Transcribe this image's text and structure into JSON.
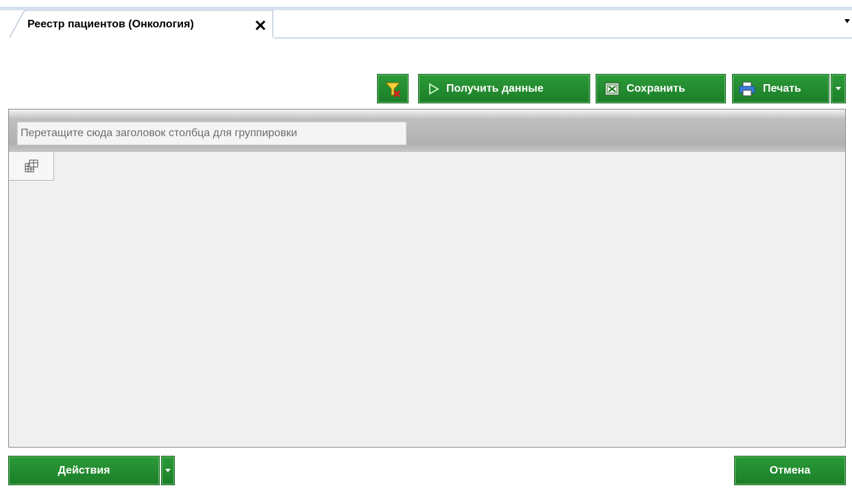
{
  "tabs": [
    {
      "label": "Реестр пациентов (Онкология)",
      "active": true
    }
  ],
  "toolbar": {
    "get_data_label": "Получить данные",
    "save_label": "Сохранить",
    "print_label": "Печать"
  },
  "grid": {
    "group_panel_hint": "Перетащите сюда заголовок столбца для группировки"
  },
  "footer": {
    "actions_label": "Действия",
    "cancel_label": "Отмена"
  },
  "icons": {
    "filter": "clear-filter-icon",
    "play": "play-icon",
    "excel": "excel-icon",
    "printer": "printer-icon",
    "chevron": "chevron-down-icon",
    "close": "close-icon",
    "column_chooser": "column-chooser-icon"
  },
  "colors": {
    "button_green": "#1f8a2c",
    "grid_background": "#f0f0f0",
    "group_panel": "#b5b5b5"
  }
}
